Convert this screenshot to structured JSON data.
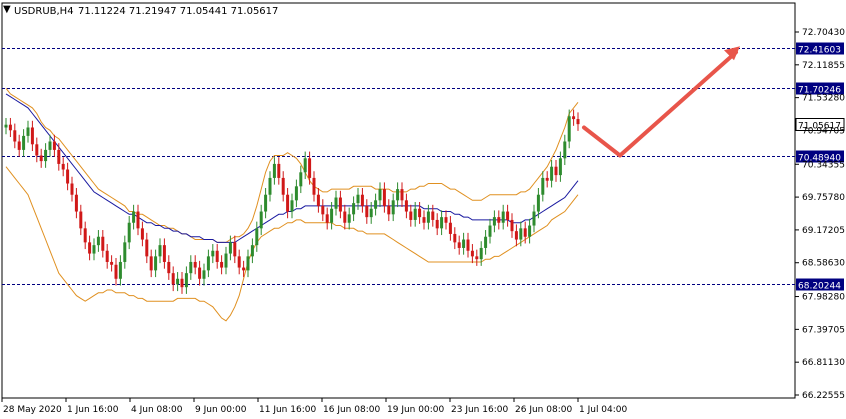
{
  "header": {
    "symbol_label": "USDRUB,H4",
    "ohlc_values": "71.11224 71.21947 71.05441 71.05617",
    "dropdown_glyph": "▼"
  },
  "chart_data": {
    "type": "candlestick",
    "symbol": "USDRUB",
    "timeframe": "H4",
    "ylim": [
      66.2,
      72.9
    ],
    "y_ticks": [
      "72.70430",
      "72.11855",
      "71.53280",
      "70.94705",
      "70.34355",
      "69.75780",
      "69.17205",
      "68.58630",
      "67.98280",
      "67.39705",
      "66.81130",
      "66.22555"
    ],
    "x_ticks": [
      "28 May 2020",
      "1 Jun 16:00",
      "4 Jun 08:00",
      "9 Jun 00:00",
      "11 Jun 16:00",
      "16 Jun 08:00",
      "19 Jun 00:00",
      "23 Jun 16:00",
      "26 Jun 08:00",
      "1 Jul 04:00"
    ],
    "horizontal_levels": [
      {
        "value": 72.41603,
        "label": "72.41603"
      },
      {
        "value": 71.70246,
        "label": "71.70246"
      },
      {
        "value": 70.4894,
        "label": "70.48940"
      },
      {
        "value": 68.20244,
        "label": "68.20244"
      }
    ],
    "current_price": {
      "value": 71.05617,
      "label": "71.05617"
    },
    "candle_closes": [
      71.05,
      70.95,
      70.75,
      70.6,
      70.85,
      71.0,
      70.7,
      70.5,
      70.4,
      70.6,
      70.75,
      70.6,
      70.35,
      70.25,
      70.0,
      69.8,
      69.5,
      69.2,
      68.95,
      68.75,
      68.9,
      69.05,
      68.8,
      68.6,
      68.55,
      68.3,
      68.6,
      68.95,
      69.3,
      69.5,
      69.2,
      69.0,
      68.7,
      68.45,
      68.7,
      68.9,
      68.6,
      68.4,
      68.2,
      68.3,
      68.15,
      68.4,
      68.6,
      68.5,
      68.3,
      68.45,
      68.7,
      68.8,
      68.6,
      68.5,
      68.75,
      68.95,
      68.7,
      68.5,
      68.45,
      68.7,
      68.9,
      69.2,
      69.5,
      69.8,
      70.1,
      70.35,
      70.1,
      69.8,
      69.5,
      69.7,
      69.95,
      70.2,
      70.45,
      70.1,
      69.8,
      69.6,
      69.45,
      69.3,
      69.55,
      69.75,
      69.5,
      69.3,
      69.45,
      69.65,
      69.8,
      69.6,
      69.4,
      69.55,
      69.7,
      69.9,
      69.6,
      69.45,
      69.7,
      69.9,
      69.7,
      69.5,
      69.35,
      69.55,
      69.4,
      69.3,
      69.5,
      69.35,
      69.2,
      69.4,
      69.3,
      69.1,
      68.95,
      68.85,
      69.0,
      68.8,
      68.7,
      68.65,
      68.85,
      69.05,
      69.25,
      69.4,
      69.3,
      69.5,
      69.35,
      69.15,
      69.0,
      69.2,
      69.05,
      69.25,
      69.5,
      69.8,
      70.1,
      70.05,
      70.3,
      70.15,
      70.45,
      70.75,
      71.2,
      71.15,
      71.06
    ],
    "bb_upper": [
      71.7,
      71.6,
      71.55,
      71.5,
      71.45,
      71.4,
      71.35,
      71.25,
      71.1,
      71.0,
      70.95,
      70.85,
      70.8,
      70.7,
      70.6,
      70.5,
      70.4,
      70.3,
      70.2,
      70.1,
      70.0,
      69.9,
      69.85,
      69.8,
      69.75,
      69.7,
      69.65,
      69.6,
      69.5,
      69.5,
      69.45,
      69.45,
      69.4,
      69.35,
      69.3,
      69.25,
      69.25,
      69.2,
      69.2,
      69.15,
      69.1,
      69.1,
      69.05,
      69.0,
      69.0,
      69.0,
      69.0,
      69.0,
      68.95,
      68.95,
      68.95,
      69.0,
      69.05,
      69.05,
      69.1,
      69.2,
      69.35,
      69.6,
      69.9,
      70.2,
      70.4,
      70.5,
      70.5,
      70.5,
      70.55,
      70.5,
      70.45,
      70.35,
      70.2,
      70.05,
      69.95,
      69.9,
      69.85,
      69.85,
      69.9,
      69.9,
      69.9,
      69.9,
      69.9,
      69.95,
      69.95,
      69.95,
      69.95,
      69.95,
      69.9,
      69.9,
      69.9,
      69.9,
      69.85,
      69.85,
      69.85,
      69.85,
      69.9,
      69.9,
      69.95,
      69.95,
      70.0,
      70.0,
      70.0,
      70.0,
      69.95,
      69.9,
      69.9,
      69.85,
      69.8,
      69.75,
      69.7,
      69.7,
      69.7,
      69.75,
      69.8,
      69.8,
      69.8,
      69.8,
      69.8,
      69.8,
      69.8,
      69.85,
      69.85,
      69.9,
      70.0,
      70.1,
      70.2,
      70.3,
      70.45,
      70.6,
      70.8,
      71.0,
      71.25,
      71.35,
      71.45
    ],
    "bb_lower": [
      70.3,
      70.2,
      70.1,
      70.0,
      69.9,
      69.8,
      69.6,
      69.4,
      69.2,
      69.0,
      68.8,
      68.6,
      68.4,
      68.3,
      68.2,
      68.1,
      68.0,
      67.95,
      67.9,
      67.95,
      68.0,
      68.05,
      68.05,
      68.1,
      68.1,
      68.05,
      68.05,
      68.05,
      68.0,
      68.0,
      67.95,
      67.95,
      67.9,
      67.9,
      67.9,
      67.9,
      67.9,
      67.9,
      67.9,
      67.95,
      67.95,
      67.95,
      67.95,
      67.95,
      67.9,
      67.9,
      67.85,
      67.8,
      67.7,
      67.6,
      67.55,
      67.65,
      67.8,
      68.0,
      68.3,
      68.6,
      68.8,
      68.95,
      69.05,
      69.1,
      69.15,
      69.2,
      69.2,
      69.25,
      69.3,
      69.3,
      69.35,
      69.35,
      69.3,
      69.3,
      69.3,
      69.3,
      69.3,
      69.3,
      69.3,
      69.25,
      69.25,
      69.2,
      69.2,
      69.2,
      69.15,
      69.15,
      69.1,
      69.1,
      69.1,
      69.1,
      69.1,
      69.05,
      69.0,
      68.95,
      68.9,
      68.85,
      68.8,
      68.75,
      68.7,
      68.65,
      68.6,
      68.6,
      68.6,
      68.6,
      68.6,
      68.6,
      68.6,
      68.6,
      68.6,
      68.6,
      68.6,
      68.6,
      68.6,
      68.65,
      68.65,
      68.7,
      68.7,
      68.75,
      68.8,
      68.85,
      68.9,
      68.95,
      69.0,
      69.05,
      69.1,
      69.15,
      69.2,
      69.25,
      69.35,
      69.4,
      69.45,
      69.5,
      69.6,
      69.7,
      69.8
    ],
    "ma_line": [
      71.6,
      71.55,
      71.5,
      71.45,
      71.4,
      71.35,
      71.25,
      71.15,
      71.05,
      70.95,
      70.85,
      70.75,
      70.65,
      70.55,
      70.45,
      70.35,
      70.25,
      70.15,
      70.05,
      69.95,
      69.85,
      69.8,
      69.75,
      69.7,
      69.65,
      69.6,
      69.55,
      69.5,
      69.45,
      69.45,
      69.4,
      69.35,
      69.3,
      69.3,
      69.25,
      69.25,
      69.2,
      69.2,
      69.15,
      69.15,
      69.1,
      69.1,
      69.05,
      69.05,
      69.05,
      69.0,
      69.0,
      69.0,
      68.95,
      68.95,
      68.95,
      68.95,
      68.95,
      69.0,
      69.05,
      69.1,
      69.15,
      69.2,
      69.25,
      69.3,
      69.35,
      69.4,
      69.45,
      69.45,
      69.5,
      69.5,
      69.55,
      69.55,
      69.6,
      69.6,
      69.6,
      69.6,
      69.6,
      69.6,
      69.6,
      69.6,
      69.6,
      69.6,
      69.6,
      69.6,
      69.6,
      69.6,
      69.6,
      69.6,
      69.6,
      69.6,
      69.6,
      69.6,
      69.6,
      69.6,
      69.6,
      69.6,
      69.6,
      69.6,
      69.6,
      69.55,
      69.55,
      69.55,
      69.55,
      69.5,
      69.5,
      69.5,
      69.45,
      69.45,
      69.4,
      69.4,
      69.35,
      69.35,
      69.35,
      69.35,
      69.35,
      69.35,
      69.35,
      69.35,
      69.35,
      69.3,
      69.3,
      69.3,
      69.35,
      69.35,
      69.4,
      69.45,
      69.5,
      69.55,
      69.6,
      69.65,
      69.7,
      69.75,
      69.85,
      69.95,
      70.05
    ],
    "colors": {
      "bull": "#2e8b2e",
      "bear": "#d01818",
      "bollinger": "#e09020",
      "ma": "#1a1aa0",
      "level": "#000080",
      "label_bg": "#000080",
      "arrow": "#e8554a",
      "grid": "#000000"
    },
    "annotation": "arrow-up-after-pullback"
  }
}
